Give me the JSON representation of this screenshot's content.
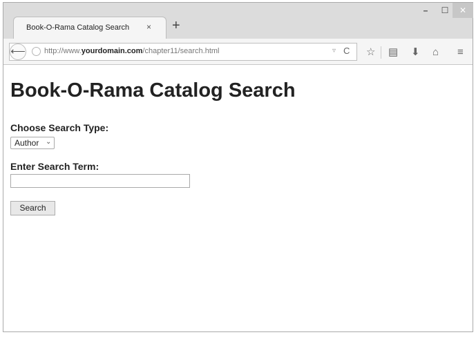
{
  "browser": {
    "tab": {
      "title": "Book-O-Rama Catalog Search",
      "close": "×"
    },
    "new_tab": "+",
    "window_controls": {
      "minimize": "–",
      "maximize": "☐",
      "close": "✕"
    },
    "address": {
      "prefix": "http://www.",
      "domain": "yourdomain.com",
      "path": "/chapter11/search.html"
    },
    "icons": {
      "back": "back-arrow-icon",
      "globe": "globe-icon",
      "dropdown": "dropdown-icon",
      "reload": "reload-icon",
      "bookmark": "star-icon",
      "reader": "clipboard-icon",
      "download": "download-icon",
      "home": "home-icon",
      "menu": "menu-icon"
    },
    "glyphs": {
      "back": "⟵",
      "dropdown": "▿",
      "reload": "C",
      "bookmark": "☆",
      "reader": "▤",
      "download": "⬇",
      "home": "⌂",
      "menu": "≡"
    }
  },
  "page": {
    "heading": "Book-O-Rama Catalog Search",
    "search_type_label": "Choose Search Type:",
    "search_type_value": "Author",
    "search_term_label": "Enter Search Term:",
    "search_term_value": "",
    "search_button": "Search"
  },
  "colors": {
    "chrome": "#dcdcdc",
    "toolbar": "#f5f5f5",
    "text": "#222222",
    "button": "#e8e8e8"
  }
}
